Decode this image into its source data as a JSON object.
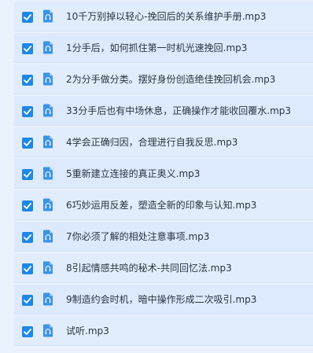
{
  "files": [
    {
      "name": "10千万别掉以轻心-挽回后的关系维护手册.mp3",
      "checked": true,
      "icon": "audio-file-icon"
    },
    {
      "name": "1分手后，如何抓住第一时机光速挽回.mp3",
      "checked": true,
      "icon": "audio-file-icon"
    },
    {
      "name": "2为分手做分类。摆好身份创造绝佳挽回机会.mp3",
      "checked": true,
      "icon": "audio-file-icon"
    },
    {
      "name": "33分手后也有中场休息，正确操作才能收回覆水.mp3",
      "checked": true,
      "icon": "audio-file-icon"
    },
    {
      "name": "4学会正确归因，合理进行自我反思.mp3",
      "checked": true,
      "icon": "audio-file-icon"
    },
    {
      "name": "5重新建立连接的真正奥义.mp3",
      "checked": true,
      "icon": "audio-file-icon"
    },
    {
      "name": "6巧妙运用反差，塑造全新的印象与认知.mp3",
      "checked": true,
      "icon": "audio-file-icon"
    },
    {
      "name": "7你必须了解的相处注意事项.mp3",
      "checked": true,
      "icon": "audio-file-icon"
    },
    {
      "name": "8引起情感共鸣的秘术-共同回忆法.mp3",
      "checked": true,
      "icon": "audio-file-icon"
    },
    {
      "name": "9制造约会时机，暗中操作形成二次吸引.mp3",
      "checked": true,
      "icon": "audio-file-icon"
    },
    {
      "name": "试听.mp3",
      "checked": true,
      "icon": "audio-file-icon"
    }
  ],
  "colors": {
    "accent": "#1e88e5",
    "background": "#e9f2fd",
    "row_background": "#ddeafd",
    "text": "#2b3441"
  }
}
